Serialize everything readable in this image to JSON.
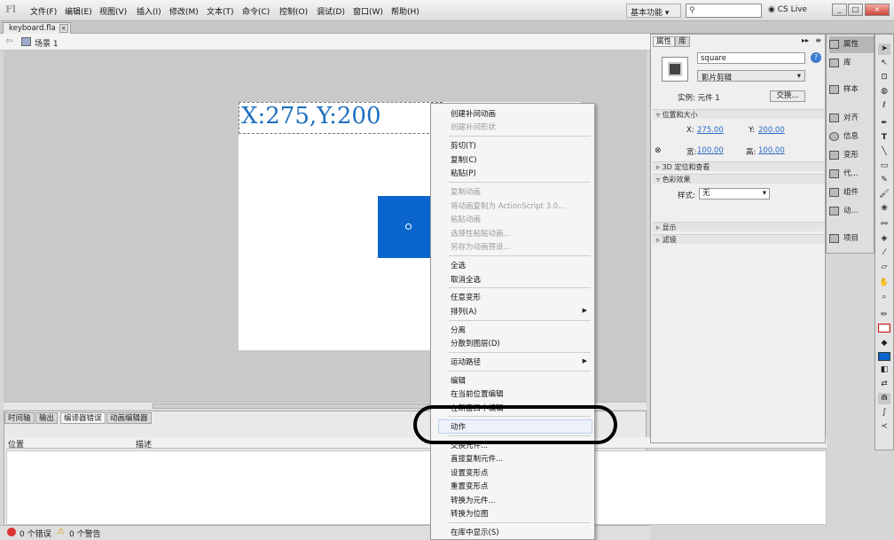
{
  "app": {
    "logo": "Fl"
  },
  "menu": [
    "文件(F)",
    "编辑(E)",
    "视图(V)",
    "插入(I)",
    "修改(M)",
    "文本(T)",
    "命令(C)",
    "控制(O)",
    "调试(D)",
    "窗口(W)",
    "帮助(H)"
  ],
  "topbar": {
    "workspace": "基本功能 ▾",
    "search_placeholder": "",
    "cslive": "CS Live",
    "min": "_",
    "restore": "□",
    "close": "×"
  },
  "document": {
    "tab": "keyboard.fla",
    "tab_close": "×",
    "scene": "场景 1"
  },
  "stage": {
    "coord_text": "X:275,Y:200"
  },
  "bottom_panel": {
    "tabs": [
      "时间轴",
      "输出",
      "编译器错误",
      "动画编辑器"
    ],
    "active_tab": 2,
    "col_location": "位置",
    "col_desc": "描述"
  },
  "status": {
    "errors": "0 个错误",
    "warnings": "0 个警告"
  },
  "properties": {
    "tabs": [
      "属性",
      "库"
    ],
    "instance_name": "square",
    "instance_type": "影片剪辑",
    "instance_of_label": "实例: 元件 1",
    "swap_button": "交换...",
    "section_pos_size": "位置和大小",
    "x_label": "X:",
    "x_value": "275.00",
    "y_label": "Y:",
    "y_value": "200.00",
    "w_label": "宽:",
    "w_value": "100.00",
    "h_label": "高:",
    "h_value": "100.00",
    "section_3d": "3D 定位和查看",
    "section_color": "色彩效果",
    "style_label": "样式:",
    "style_value": "无",
    "section_display": "显示",
    "section_filters": "滤镜"
  },
  "side_panel": [
    "属性",
    "库",
    "样本",
    "对齐",
    "信息",
    "变形",
    "代...",
    "组件",
    "动...",
    "项目"
  ],
  "context_menu": {
    "items": [
      {
        "label": "创建补间动画",
        "disabled": false
      },
      {
        "label": "创建补间形状",
        "disabled": true
      },
      {
        "label": "剪切(T)",
        "disabled": false
      },
      {
        "label": "复制(C)",
        "disabled": false
      },
      {
        "label": "粘贴(P)",
        "disabled": false
      },
      {
        "label": "复制动画",
        "disabled": true
      },
      {
        "label": "将动画复制为 ActionScript 3.0...",
        "disabled": true
      },
      {
        "label": "粘贴动画",
        "disabled": true
      },
      {
        "label": "选择性粘贴动画...",
        "disabled": true
      },
      {
        "label": "另存为动画预设...",
        "disabled": true
      },
      {
        "label": "全选",
        "disabled": false
      },
      {
        "label": "取消全选",
        "disabled": false
      },
      {
        "label": "任意变形",
        "disabled": false
      },
      {
        "label": "排列(A)",
        "disabled": false
      },
      {
        "label": "分离",
        "disabled": false
      },
      {
        "label": "分散到图层(D)",
        "disabled": false
      },
      {
        "label": "运动路径",
        "disabled": false
      },
      {
        "label": "编辑",
        "disabled": false
      },
      {
        "label": "在当前位置编辑",
        "disabled": false
      },
      {
        "label": "在新窗口中编辑",
        "disabled": false
      },
      {
        "label": "动作",
        "disabled": false
      },
      {
        "label": "交换元件...",
        "disabled": false
      },
      {
        "label": "直接复制元件...",
        "disabled": false
      },
      {
        "label": "设置变形点",
        "disabled": false
      },
      {
        "label": "重置变形点",
        "disabled": false
      },
      {
        "label": "转换为元件...",
        "disabled": false
      },
      {
        "label": "转换为位图",
        "disabled": false
      },
      {
        "label": "在库中显示(S)",
        "disabled": false
      }
    ],
    "submenu_arrow": "▶"
  },
  "colors": {
    "accent_blue": "#0a66cc",
    "text_blue": "#1f6fc0"
  }
}
